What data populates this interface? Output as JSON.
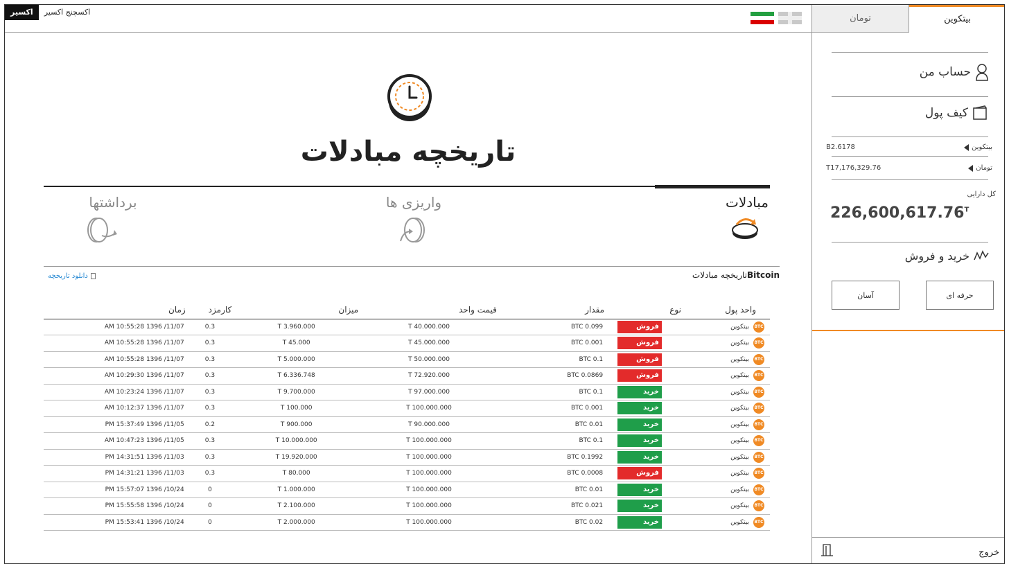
{
  "brand": {
    "badge": "اکسیر",
    "name": "اکسچنج اکسیر"
  },
  "colors": {
    "accent": "#f08a24",
    "sell": "#e32b2b",
    "buy": "#1f9e4a",
    "link": "#2a8bd4"
  },
  "sidebar": {
    "tabs": [
      {
        "label": "بیتکوین",
        "active": true
      },
      {
        "label": "تومان",
        "active": false
      }
    ],
    "account_label": "حساب من",
    "wallet_label": "کیف پول",
    "balances": [
      {
        "label": "بیتکوین",
        "value": "B2.6178"
      },
      {
        "label": "تومان",
        "value": "T17,176,329.76"
      }
    ],
    "total_label": "کل دارایی",
    "total_value": "226,600,617.76",
    "total_unit": "T",
    "trade_label": "خرید و فروش",
    "buttons": {
      "pro": "حرفه ای",
      "easy": "آسان"
    },
    "logout_label": "خروج"
  },
  "main": {
    "title": "تاریخچه مبادلات",
    "tabs": {
      "trades": "مبادلات",
      "deposits": "واریزی ها",
      "withdrawals": "برداشتها"
    },
    "section_currency": "Bitcoin",
    "section_title": "تاریخچه مبادلات",
    "download_label": "دانلود تاریخچه",
    "columns": {
      "currency": "واحد پول",
      "type": "نوع",
      "amount": "مقدار",
      "unit_price": "قیمت واحد",
      "total": "میزان",
      "fee": "کارمزد",
      "time": "زمان"
    },
    "rows": [
      {
        "icon": "BTC",
        "currency": "بیتکوین",
        "type": "فروش",
        "kind": "sell",
        "amount": "BTC 0.099",
        "unit_price": "T 40.000.000",
        "total": "T 3.960.000",
        "fee": "0.3",
        "time": "AM 10:55:28 1396 /11/07"
      },
      {
        "icon": "BTC",
        "currency": "بیتکوین",
        "type": "فروش",
        "kind": "sell",
        "amount": "BTC 0.001",
        "unit_price": "T 45.000.000",
        "total": "T 45.000",
        "fee": "0.3",
        "time": "AM 10:55:28 1396 /11/07"
      },
      {
        "icon": "BTC",
        "currency": "بیتکوین",
        "type": "فروش",
        "kind": "sell",
        "amount": "BTC 0.1",
        "unit_price": "T 50.000.000",
        "total": "T 5.000.000",
        "fee": "0.3",
        "time": "AM 10:55:28 1396 /11/07"
      },
      {
        "icon": "BTC",
        "currency": "بیتکوین",
        "type": "فروش",
        "kind": "sell",
        "amount": "BTC 0.0869",
        "unit_price": "T 72.920.000",
        "total": "T 6.336.748",
        "fee": "0.3",
        "time": "AM 10:29:30 1396 /11/07"
      },
      {
        "icon": "BTC",
        "currency": "بیتکوین",
        "type": "خرید",
        "kind": "buy",
        "amount": "BTC 0.1",
        "unit_price": "T 97.000.000",
        "total": "T 9.700.000",
        "fee": "0.3",
        "time": "AM 10:23:24 1396 /11/07"
      },
      {
        "icon": "BTC",
        "currency": "بیتکوین",
        "type": "خرید",
        "kind": "buy",
        "amount": "BTC 0.001",
        "unit_price": "T 100.000.000",
        "total": "T 100.000",
        "fee": "0.3",
        "time": "AM 10:12:37 1396 /11/07"
      },
      {
        "icon": "BTC",
        "currency": "بیتکوین",
        "type": "خرید",
        "kind": "buy",
        "amount": "BTC 0.01",
        "unit_price": "T 90.000.000",
        "total": "T 900.000",
        "fee": "0.2",
        "time": "PM 15:37:49 1396 /11/05"
      },
      {
        "icon": "BTC",
        "currency": "بیتکوین",
        "type": "خرید",
        "kind": "buy",
        "amount": "BTC 0.1",
        "unit_price": "T 100.000.000",
        "total": "T 10.000.000",
        "fee": "0.3",
        "time": "AM 10:47:23 1396 /11/05"
      },
      {
        "icon": "BTC",
        "currency": "بیتکوین",
        "type": "خرید",
        "kind": "buy",
        "amount": "BTC 0.1992",
        "unit_price": "T 100.000.000",
        "total": "T 19.920.000",
        "fee": "0.3",
        "time": "PM 14:31:51 1396 /11/03"
      },
      {
        "icon": "BTC",
        "currency": "بیتکوین",
        "type": "فروش",
        "kind": "sell",
        "amount": "BTC 0.0008",
        "unit_price": "T 100.000.000",
        "total": "T 80.000",
        "fee": "0.3",
        "time": "PM 14:31:21 1396 /11/03"
      },
      {
        "icon": "BTC",
        "currency": "بیتکوین",
        "type": "خرید",
        "kind": "buy",
        "amount": "BTC 0.01",
        "unit_price": "T 100.000.000",
        "total": "T 1.000.000",
        "fee": "0",
        "time": "PM 15:57:07 1396 /10/24"
      },
      {
        "icon": "BTC",
        "currency": "بیتکوین",
        "type": "خرید",
        "kind": "buy",
        "amount": "BTC 0.021",
        "unit_price": "T 100.000.000",
        "total": "T 2.100.000",
        "fee": "0",
        "time": "PM 15:55:58 1396 /10/24"
      },
      {
        "icon": "BTC",
        "currency": "بیتکوین",
        "type": "خرید",
        "kind": "buy",
        "amount": "BTC 0.02",
        "unit_price": "T 100.000.000",
        "total": "T 2.000.000",
        "fee": "0",
        "time": "PM 15:53:41 1396 /10/24"
      }
    ]
  }
}
